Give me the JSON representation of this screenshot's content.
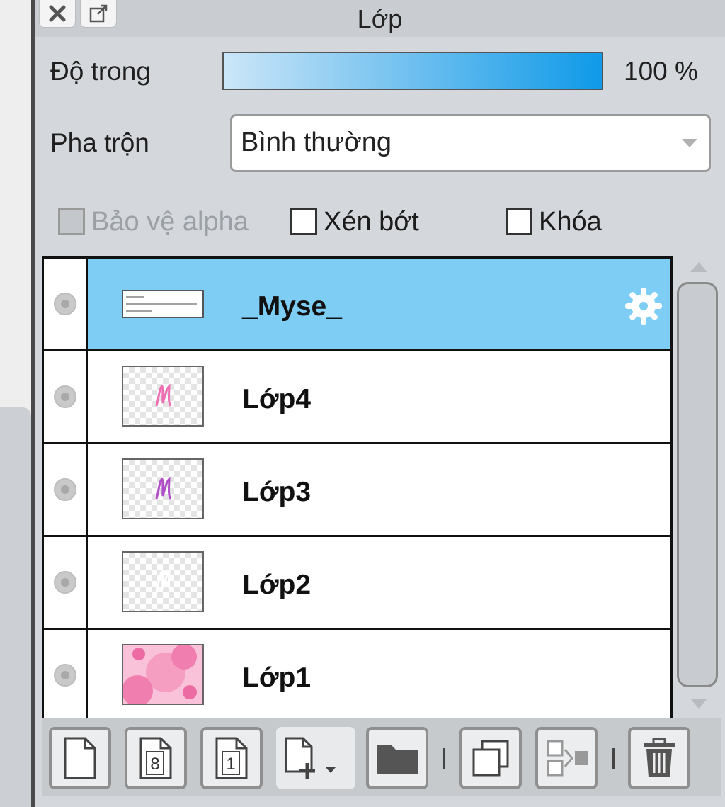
{
  "panel": {
    "title": "Lớp",
    "close_icon": "close-icon",
    "popout_icon": "popout-icon"
  },
  "opacity": {
    "label": "Độ trong",
    "value_text": "100 %",
    "level": 1.0
  },
  "blend": {
    "label": "Pha trộn",
    "value": "Bình thường"
  },
  "options": {
    "protect_alpha": {
      "label": "Bảo vệ alpha",
      "checked": false,
      "enabled": false
    },
    "clip": {
      "label": "Xén bớt",
      "checked": false,
      "enabled": true
    },
    "lock": {
      "label": "Khóa",
      "checked": false,
      "enabled": true
    }
  },
  "layers": [
    {
      "name": "_Myse_",
      "selected": true,
      "thumbnail": "text",
      "has_settings": true
    },
    {
      "name": "Lớp4",
      "selected": false,
      "thumbnail": "pink-m"
    },
    {
      "name": "Lớp3",
      "selected": false,
      "thumbnail": "purple-m"
    },
    {
      "name": "Lớp2",
      "selected": false,
      "thumbnail": "white-m"
    },
    {
      "name": "Lớp1",
      "selected": false,
      "thumbnail": "pink-dots"
    }
  ],
  "toolbar": [
    "new-layer-icon",
    "new-8bit-layer-icon",
    "new-1bit-layer-icon",
    "add-layer-dropdown-icon",
    "new-folder-icon",
    "duplicate-layer-icon",
    "merge-down-icon",
    "delete-layer-icon"
  ],
  "colors": {
    "selected_row": "#7ecdf5",
    "opacity_bar_end": "#0f9ae8",
    "panel_bg": "#d4d8dc"
  }
}
